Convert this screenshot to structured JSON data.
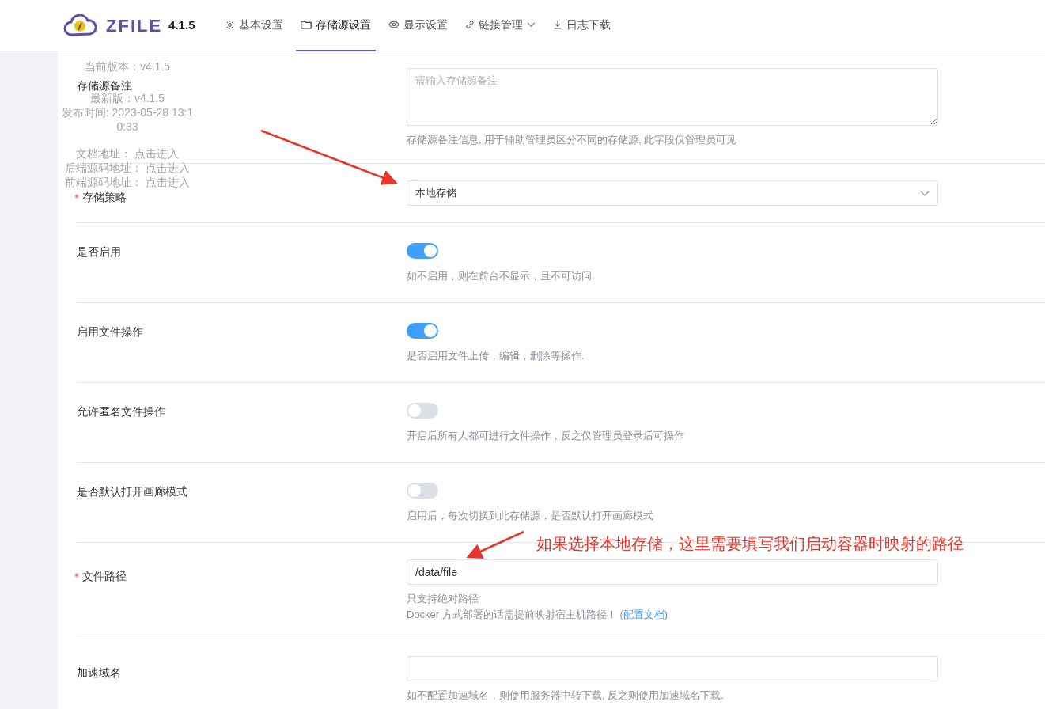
{
  "header": {
    "logo": "ZFILE",
    "version": "4.1.5",
    "nav": [
      {
        "label": "基本设置",
        "selected": false,
        "dropdown": false
      },
      {
        "label": "存储源设置",
        "selected": true,
        "dropdown": false
      },
      {
        "label": "显示设置",
        "selected": false,
        "dropdown": false
      },
      {
        "label": "链接管理",
        "selected": false,
        "dropdown": true
      },
      {
        "label": "日志下载",
        "selected": false,
        "dropdown": false
      }
    ]
  },
  "version_popup": {
    "lines": [
      "当前版本：v4.1.5",
      "最新版：v4.1.5",
      "发布时间: 2023-05-28 13:10:33"
    ],
    "links": [
      {
        "label": "文档地址：",
        "link": "点击进入"
      },
      {
        "label": "后端源码地址：",
        "link": "点击进入"
      },
      {
        "label": "前端源码地址：",
        "link": "点击进入"
      }
    ]
  },
  "form": [
    {
      "kind": "textarea",
      "label": "存储源备注",
      "required": false,
      "placeholder": "请输入存储源备注",
      "hints": [
        "存储源备注信息, 用于辅助管理员区分不同的存储源, 此字段仅管理员可见"
      ]
    },
    {
      "kind": "select",
      "label": "存储策略",
      "required": true,
      "value": "本地存储"
    },
    {
      "kind": "switch",
      "label": "是否启用",
      "required": false,
      "on": true,
      "hints": [
        "如不启用，则在前台不显示，且不可访问."
      ]
    },
    {
      "kind": "switch",
      "label": "启用文件操作",
      "required": false,
      "on": true,
      "hints": [
        "是否启用文件上传，编辑，删除等操作."
      ]
    },
    {
      "kind": "switch",
      "label": "允许匿名文件操作",
      "required": false,
      "on": false,
      "hints": [
        "开启后所有人都可进行文件操作，反之仅管理员登录后可操作"
      ]
    },
    {
      "kind": "switch",
      "label": "是否默认打开画廊模式",
      "required": false,
      "on": false,
      "hints": [
        "启用后，每次切换到此存储源，是否默认打开画廊模式"
      ]
    },
    {
      "kind": "input",
      "label": "文件路径",
      "required": true,
      "value": "/data/file",
      "hints": [
        "只支持绝对路径"
      ],
      "doc_hint": {
        "text": "Docker 方式部署的话需提前映射宿主机路径！ (",
        "link": "配置文档",
        "after": ")"
      }
    },
    {
      "kind": "input",
      "label": "加速域名",
      "required": false,
      "hints": [
        "如不配置加速域名，则使用服务器中转下载, 反之则使用加速域名下载."
      ]
    }
  ],
  "annotation": {
    "text": "如果选择本地存储，这里需要填写我们启动容器时映射的路径"
  }
}
